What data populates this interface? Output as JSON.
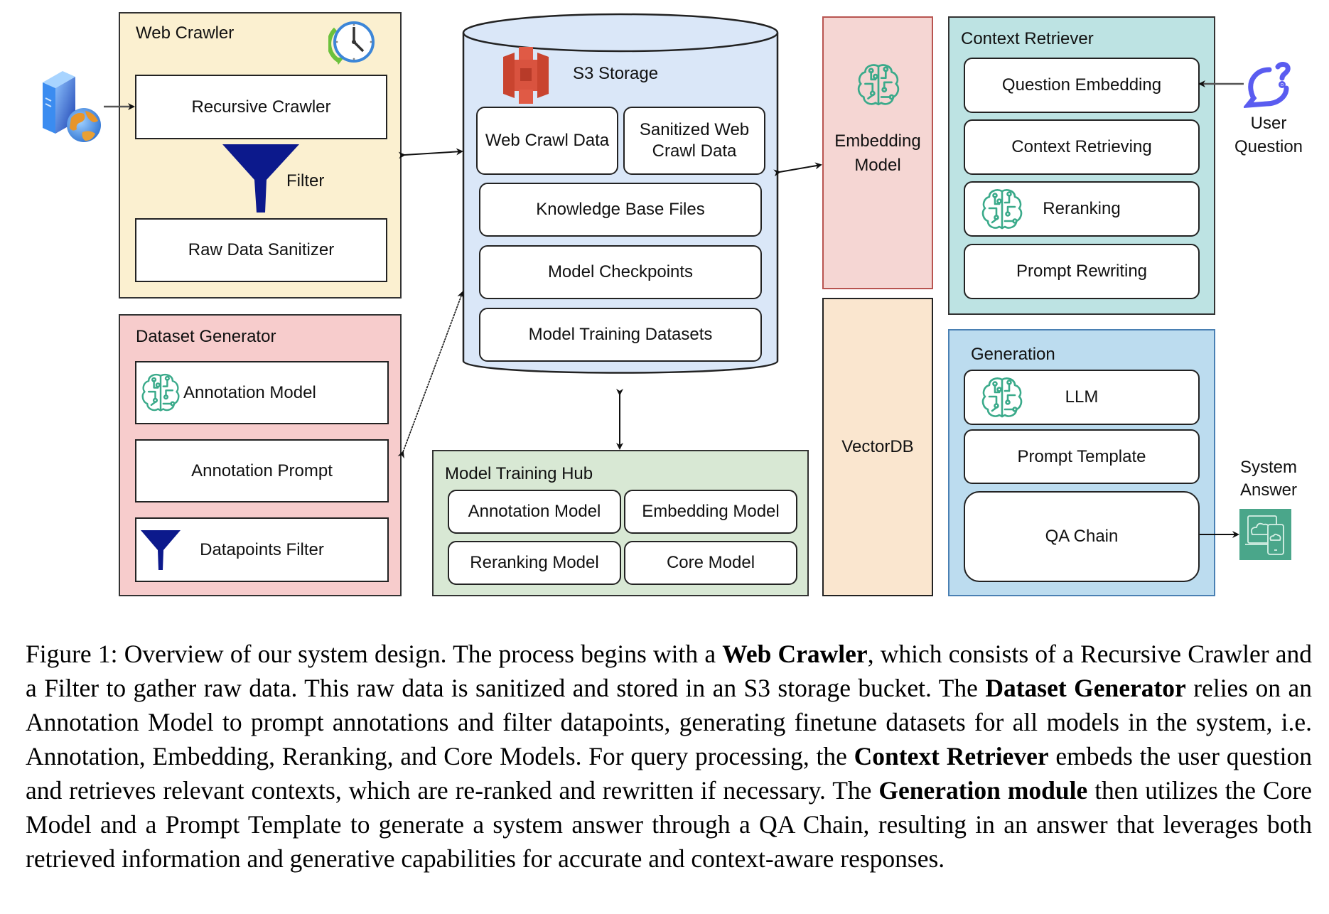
{
  "diagram": {
    "inputs": {
      "web_source_icon": "server-globe-icon",
      "user_question_label_1": "User",
      "user_question_label_2": "Question",
      "system_answer_label_1": "System",
      "system_answer_label_2": "Answer"
    },
    "web_crawler": {
      "title": "Web Crawler",
      "recursive_crawler": "Recursive Crawler",
      "filter_label": "Filter",
      "raw_data_sanitizer": "Raw Data Sanitizer"
    },
    "dataset_generator": {
      "title": "Dataset Generator",
      "annotation_model": "Annotation Model",
      "annotation_prompt": "Annotation Prompt",
      "datapoints_filter": "Datapoints Filter"
    },
    "s3_storage": {
      "title": "S3 Storage",
      "web_crawl_data": "Web Crawl Data",
      "sanitized_web_crawl_data": "Sanitized Web Crawl Data",
      "knowledge_base_files": "Knowledge Base Files",
      "model_checkpoints": "Model Checkpoints",
      "model_training_datasets": "Model Training Datasets"
    },
    "model_training_hub": {
      "title": "Model Training Hub",
      "annotation_model": "Annotation Model",
      "embedding_model": "Embedding Model",
      "reranking_model": "Reranking Model",
      "core_model": "Core Model"
    },
    "embedding_model": {
      "label_1": "Embedding",
      "label_2": "Model"
    },
    "vectordb": {
      "label": "VectorDB"
    },
    "context_retriever": {
      "title": "Context Retriever",
      "question_embedding": "Question Embedding",
      "context_retrieving": "Context Retrieving",
      "reranking": "Reranking",
      "prompt_rewriting": "Prompt Rewriting"
    },
    "generation": {
      "title": "Generation",
      "llm": "LLM",
      "prompt_template": "Prompt Template",
      "qa_chain": "QA Chain"
    },
    "colors": {
      "web_crawler_fill": "#fbf0d0",
      "dataset_generator_fill": "#f7cccc",
      "s3_fill": "#dae7f8",
      "model_hub_fill": "#d8e8d4",
      "embedding_fill": "#f5d6d3",
      "embedding_border": "#b85450",
      "vectordb_fill": "#fae6cf",
      "context_retriever_fill": "#bde3e3",
      "generation_fill": "#bcdcef",
      "generation_border": "#4a80b3",
      "funnel": "#0c198c",
      "brain": "#3aaa8a",
      "s3_logo": "#d9533f",
      "user_icon": "#5a5cf0",
      "answer_icon": "#4aa68a"
    }
  },
  "caption": {
    "prefix": "Figure 1: Overview of our system design. The process begins with a ",
    "b1": "Web Crawler",
    "t1": ", which consists of a Recursive Crawler and a Filter to gather raw data. This raw data is sanitized and stored in an S3 storage bucket. The ",
    "b2": "Dataset Generator",
    "t2": " relies on an Annotation Model to prompt annotations and filter datapoints, generating finetune datasets for all models in the system, i.e. Annotation, Embedding, Reranking, and Core Models. For query processing, the ",
    "b3": "Context Retriever",
    "t3": " embeds the user question and retrieves relevant contexts, which are re-ranked and rewritten if necessary. The ",
    "b4": "Generation module",
    "t4": " then utilizes the Core Model and a Prompt Template to generate a system answer through a QA Chain, resulting in an answer that leverages both retrieved information and generative capabilities for accurate and context-aware responses."
  }
}
